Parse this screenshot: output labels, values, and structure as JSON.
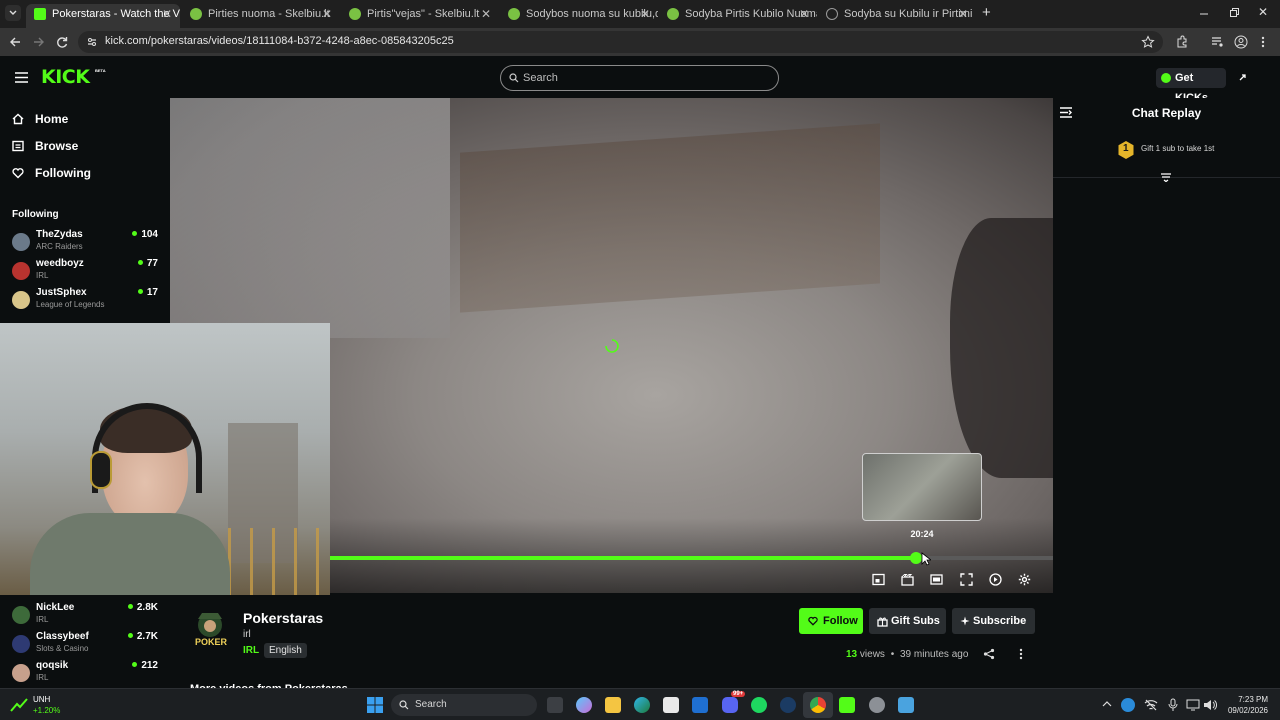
{
  "browser": {
    "tabs": [
      {
        "label": "Pokerstaras - Watch the VOD",
        "active": true,
        "favicon_color": "#53fc18"
      },
      {
        "label": "Pirties nuoma - Skelbiu.lt",
        "active": false,
        "favicon_color": "#7ac143"
      },
      {
        "label": "Pirtis\"vejas\" - Skelbiu.lt",
        "active": false,
        "favicon_color": "#7ac143"
      },
      {
        "label": "Sodybos nuoma su kubilu,džiak",
        "active": false,
        "favicon_color": "#7ac143"
      },
      {
        "label": "Sodyba Pirtis Kubilo Nuoma so",
        "active": false,
        "favicon_color": "#7ac143"
      },
      {
        "label": "Sodyba su Kubilu ir Pirtimi - Nu",
        "active": false,
        "favicon_color": "#9a9a9a"
      }
    ],
    "url": "kick.com/pokerstaras/videos/18111084-b372-4248-a8ec-085843205c25"
  },
  "header": {
    "logo": "KICK",
    "logo_badge": "BETA",
    "search_placeholder": "Search",
    "get_kicks": "Get KICKs"
  },
  "sidebar": {
    "nav": [
      {
        "label": "Home",
        "icon": "home-icon"
      },
      {
        "label": "Browse",
        "icon": "browse-icon"
      },
      {
        "label": "Following",
        "icon": "heart-icon"
      }
    ],
    "following_title": "Following",
    "following": [
      {
        "name": "TheZydas",
        "category": "ARC Raiders",
        "viewers": "104",
        "avatar_color": "#6b7a8a"
      },
      {
        "name": "weedboyz",
        "category": "IRL",
        "viewers": "77",
        "avatar_color": "#b8332f"
      },
      {
        "name": "JustSphex",
        "category": "League of Legends",
        "viewers": "17",
        "avatar_color": "#d9c58a"
      }
    ],
    "recommended": [
      {
        "name": "NickLee",
        "category": "IRL",
        "viewers": "2.8K",
        "avatar_color": "#3d6a3a"
      },
      {
        "name": "Classybeef",
        "category": "Slots & Casino",
        "viewers": "2.7K",
        "avatar_color": "#2e3a73"
      },
      {
        "name": "qoqsik",
        "category": "IRL",
        "viewers": "212",
        "avatar_color": "#c7a08c"
      }
    ]
  },
  "player": {
    "hover_time": "20:24",
    "progress": 0.81
  },
  "chat": {
    "title": "Chat Replay",
    "gift_rank": "1",
    "gift_text": "Gift 1 sub to take 1st"
  },
  "channel": {
    "name": "Pokerstaras",
    "avatar_text": "POKER",
    "title": "irl",
    "category": "IRL",
    "language": "English",
    "follow_label": "Follow",
    "gift_label": "Gift Subs",
    "subscribe_label": "Subscribe",
    "views_count": "13",
    "views_label": "views",
    "separator": "•",
    "time_ago": "39 minutes ago",
    "more_videos": "More videos from Pokerstaras"
  },
  "taskbar": {
    "stock_name": "UNH",
    "stock_change": "+1.20%",
    "search_label": "Search",
    "time": "7:23 PM",
    "date": "09/02/2026",
    "badge": "99+"
  },
  "colors": {
    "accent": "#53fc18",
    "background": "#0b0e0f"
  }
}
